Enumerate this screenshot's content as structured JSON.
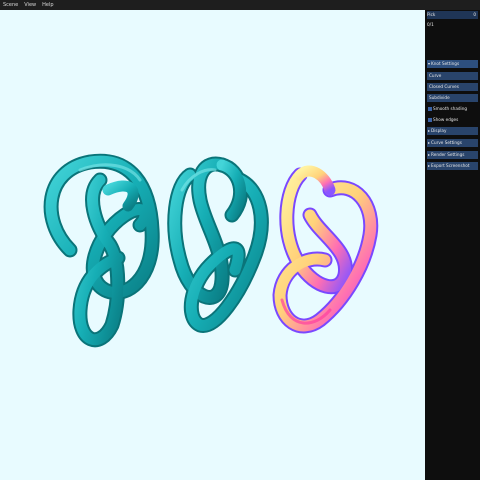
{
  "menubar": {
    "items": [
      "Scene",
      "View",
      "Help"
    ]
  },
  "panel": {
    "search": {
      "label": "Pick",
      "value": "0"
    },
    "sub_text": "0/1",
    "section_header": "Knot Settings",
    "rows": [
      {
        "label": "Curve"
      },
      {
        "label": "Closed Curves"
      },
      {
        "label": "Subdivide"
      }
    ],
    "checkboxes": [
      {
        "label": "Smooth shading",
        "checked": true
      },
      {
        "label": "Show edges",
        "checked": true
      }
    ],
    "sections": [
      "Display",
      "Curve Settings",
      "Render Settings",
      "Export Screenshot"
    ]
  }
}
